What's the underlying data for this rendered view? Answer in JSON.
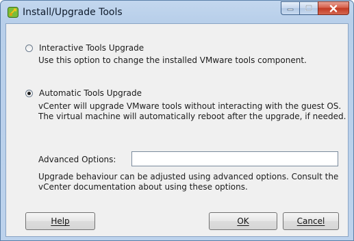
{
  "window": {
    "title": "Install/Upgrade Tools",
    "icon": "vmware-tools-icon"
  },
  "options": {
    "interactive": {
      "label": "Interactive Tools Upgrade",
      "description": "Use this option to change the installed VMware tools component.",
      "selected": false
    },
    "automatic": {
      "label": "Automatic Tools Upgrade",
      "description_line1": "vCenter will upgrade VMware tools without interacting with the guest OS.",
      "description_line2": "The virtual machine will automatically reboot after the upgrade, if needed.",
      "selected": true
    }
  },
  "advanced": {
    "label": "Advanced Options:",
    "value": "",
    "help_line1": "Upgrade behaviour can be adjusted using advanced options. Consult the",
    "help_line2": "vCenter documentation about using these options."
  },
  "buttons": {
    "help": "Help",
    "ok": "OK",
    "cancel": "Cancel"
  },
  "colors": {
    "titlebar": "#b8cfea",
    "client": "#f0f0f0",
    "close": "#c23a22"
  }
}
